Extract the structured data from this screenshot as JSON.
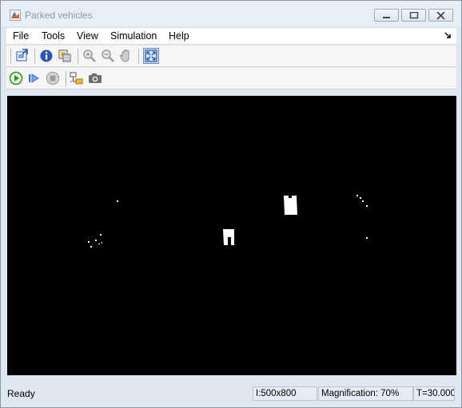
{
  "window": {
    "title": "Parked vehicles",
    "controls": [
      "minimize",
      "maximize",
      "close"
    ]
  },
  "menu": {
    "items": [
      "File",
      "Tools",
      "View",
      "Simulation",
      "Help"
    ]
  },
  "toolbar1": {
    "buttons": [
      "export-to-workspace",
      "image-information",
      "pixel-region",
      "zoom-in",
      "zoom-out",
      "pan",
      "maintain-fit-to-window"
    ],
    "active": "maintain-fit-to-window"
  },
  "toolbar2": {
    "buttons": [
      "start-simulation",
      "step-forward",
      "stop",
      "highlight-simulink-block",
      "snapshot"
    ]
  },
  "status": {
    "text": "Ready",
    "dimensions": "I:500x800",
    "magnification": "Magnification: 70%",
    "time": "T=30.000"
  },
  "colors": {
    "titlebar": "#e8eef6",
    "display_background": "#000000",
    "blob": "#ffffff",
    "play_green": "#2f8f1f",
    "step_blue": "#3d6fd1"
  }
}
